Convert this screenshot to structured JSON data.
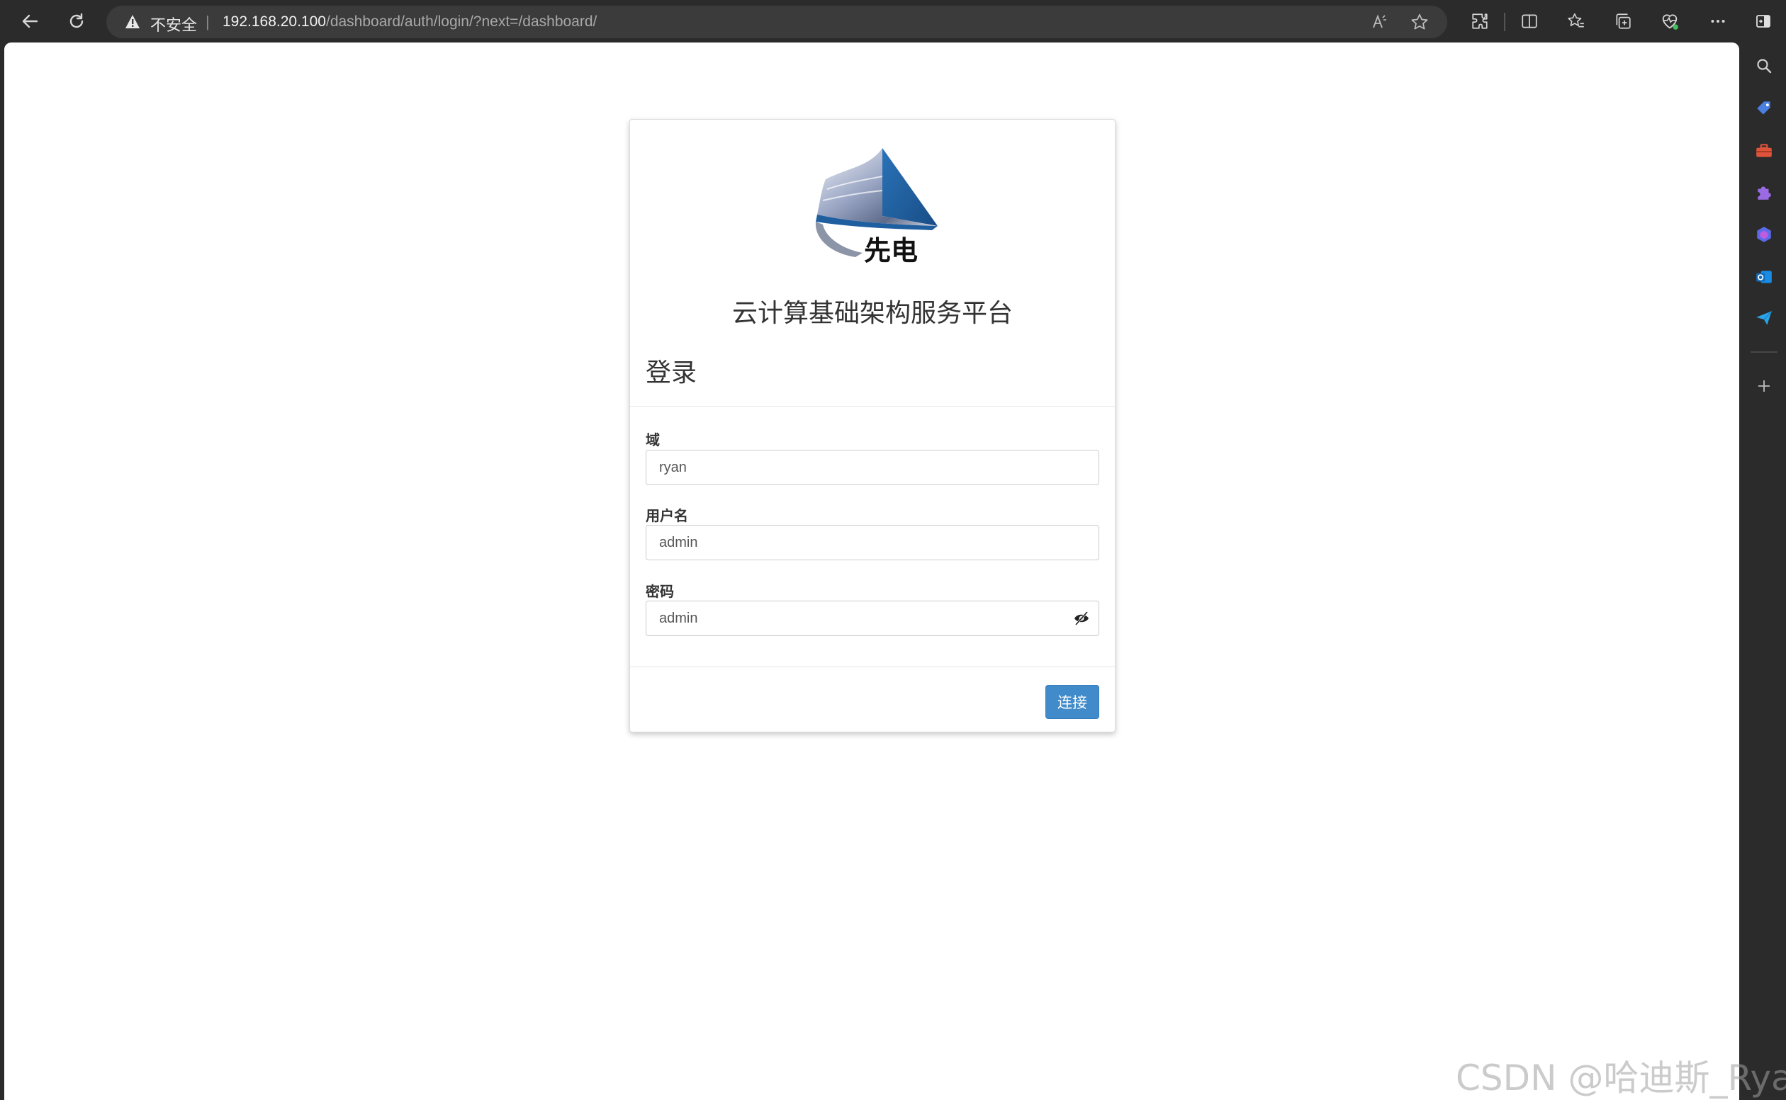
{
  "browser": {
    "address_bar": {
      "security_label": "不安全",
      "url_host": "192.168.20.100",
      "url_path": "/dashboard/auth/login/?next=/dashboard/"
    },
    "icons": {
      "back": "back-arrow-icon",
      "reload": "reload-icon",
      "read_aloud": "read-aloud-icon",
      "favorite": "star-icon",
      "extensions": "extensions-icon",
      "split_screen": "split-screen-icon",
      "favorites": "favorites-icon",
      "collections": "collections-icon",
      "browser_essentials": "heart-pulse-icon",
      "more": "more-icon",
      "sidebar_toggle": "sidebar-toggle-icon"
    }
  },
  "sidebar": {
    "items": [
      "search-icon",
      "tag-icon",
      "toolbox-icon",
      "puzzle-icon",
      "copilot-icon",
      "outlook-icon",
      "send-icon",
      "add-icon"
    ]
  },
  "login": {
    "brand_title": "云计算基础架构服务平台",
    "logo_text": "先电",
    "heading": "登录",
    "domain_label": "域",
    "domain_value": "ryan",
    "username_label": "用户名",
    "username_value": "admin",
    "password_label": "密码",
    "password_value": "admin",
    "submit_label": "连接"
  },
  "watermark": "CSDN @哈迪斯_Ryan",
  "colors": {
    "primary_button": "#428bca",
    "chrome_dark": "#2b2b2b",
    "page_bg": "#ffffff",
    "logo_blue": "#1f5fa0"
  }
}
